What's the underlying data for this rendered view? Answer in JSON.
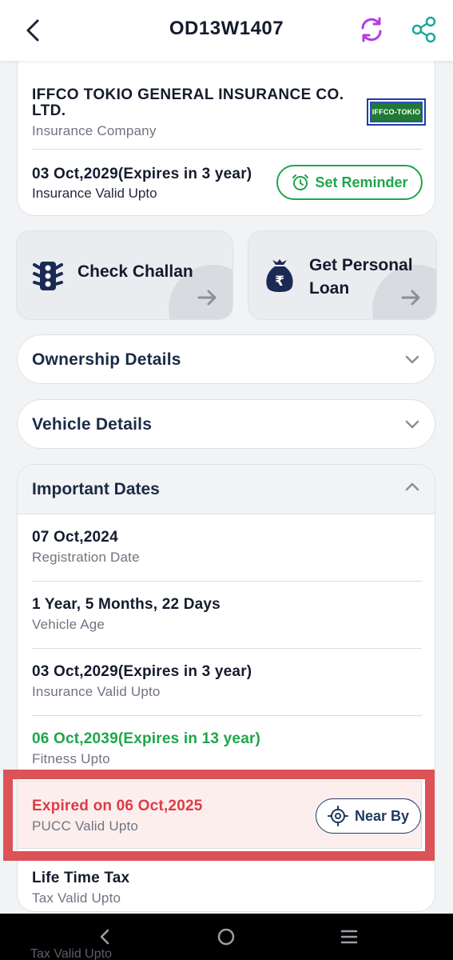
{
  "header": {
    "title": "OD13W1407",
    "back_icon": "chevron-left-icon",
    "refresh_icon": "refresh-icon",
    "share_icon": "share-icon",
    "colors": {
      "refresh": "#b13de0",
      "share": "#1aa89a"
    }
  },
  "insurance": {
    "company": "IFFCO TOKIO GENERAL INSURANCE CO. LTD.",
    "company_label": "Insurance Company",
    "logo_text": "IFFCO-TOKIO",
    "valid_upto": "03 Oct,2029(Expires in 3 year)",
    "valid_upto_label": "Insurance Valid Upto",
    "reminder_button": "Set Reminder",
    "reminder_icon": "alarm-clock-icon"
  },
  "quick_actions": [
    {
      "label": "Check Challan",
      "icon": "traffic-light-icon"
    },
    {
      "label": "Get Personal Loan",
      "icon": "money-bag-icon"
    }
  ],
  "accordions": {
    "ownership": "Ownership Details",
    "vehicle": "Vehicle Details",
    "important_dates": "Important Dates"
  },
  "important_dates": [
    {
      "value": "07 Oct,2024",
      "label": "Registration Date"
    },
    {
      "value": "1 Year, 5 Months, 22 Days",
      "label": "Vehicle Age"
    },
    {
      "value": "03 Oct,2029(Expires in 3 year)",
      "label": "Insurance Valid Upto"
    },
    {
      "value": "06 Oct,2039(Expires in 13 year)",
      "label": "Fitness Upto",
      "status": "valid"
    }
  ],
  "pucc": {
    "value": "Expired on 06 Oct,2025",
    "label": "PUCC Valid Upto",
    "nearby_button": "Near By",
    "nearby_icon": "locate-icon",
    "status": "expired"
  },
  "tax": {
    "value": "Life Time Tax",
    "label": "Tax Valid Upto"
  },
  "navbar": {
    "peek_text": "Tax Valid Upto",
    "icons": [
      "back-nav-icon",
      "home-nav-icon",
      "recents-nav-icon"
    ]
  },
  "colors": {
    "green": "#1fa54b",
    "red": "#dc3d45",
    "highlight_border": "#dc5257",
    "navy": "#1b2a45"
  }
}
